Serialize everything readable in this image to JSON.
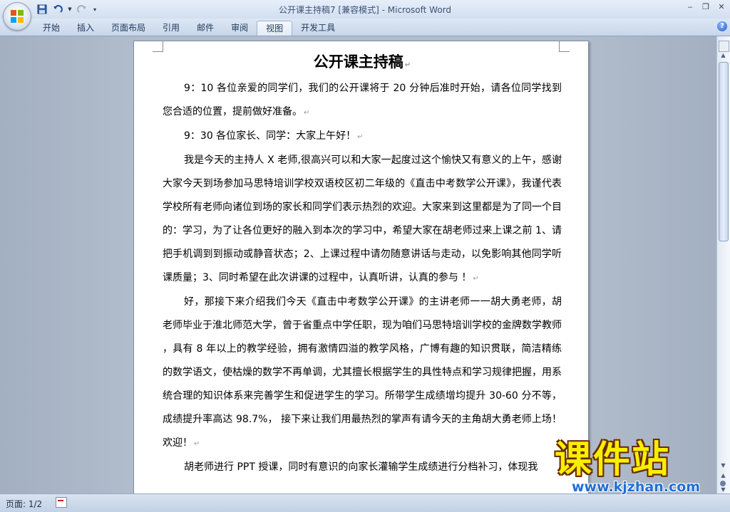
{
  "window": {
    "title_doc": "公开课主持稿7 [兼容模式]",
    "title_sep": " - ",
    "title_app": "Microsoft Word"
  },
  "ribbon": {
    "tabs": [
      {
        "label": "开始"
      },
      {
        "label": "插入"
      },
      {
        "label": "页面布局"
      },
      {
        "label": "引用"
      },
      {
        "label": "邮件"
      },
      {
        "label": "审阅"
      },
      {
        "label": "视图"
      },
      {
        "label": "开发工具"
      }
    ],
    "active_tab": "视图"
  },
  "document": {
    "title": "公开课主持稿",
    "paragraphs": [
      "9：10 各位亲爱的同学们，我们的公开课将于 20 分钟后准时开始，请各位同学找到您合适的位置，提前做好准备。",
      "9：30 各位家长、同学：大家上午好！",
      "我是今天的主持人 X 老师,很高兴可以和大家一起度过这个愉快又有意义的上午，感谢大家今天到场参加马思特培训学校双语校区初二年级的《直击中考数学公开课》，我谨代表学校所有老师向诸位到场的家长和同学们表示热烈的欢迎。大家来到这里都是为了同一个目的：学习，为了让各位更好的融入到本次的学习中，希望大家在胡老师过来上课之前 1、请把手机调到到振动或静音状态；2、上课过程中请勿随意讲话与走动，以免影响其他同学听课质量；3、同时希望在此次讲课的过程中，认真听讲，认真的参与 ！",
      "好，那接下来介绍我们今天《直击中考数学公开课》的主讲老师一一胡大勇老师，胡老师毕业于淮北师范大学，曾于省重点中学任职，现为咱们马思特培训学校的金牌数学教师 ，具有 8 年以上的教学经验，拥有激情四溢的教学风格，广博有趣的知识贯联，简洁精练的数学语文，使枯燥的数学不再单调，尤其擅长根据学生的具性特点和学习规律把握，用系统合理的知识体系来完善学生和促进学生的学习。所带学生成绩增均提升 30-60 分不等，成绩提升率高达 98.7%， 接下来让我们用最热烈的掌声有请今天的主角胡大勇老师上场！欢迎！",
      "胡老师进行 PPT 授课，同时有意识的向家长灌输学生成绩进行分档补习，体现我"
    ]
  },
  "status": {
    "page": "页面: 1/2"
  },
  "watermark": {
    "main": "课件站",
    "url": "www.kjzhan.com"
  }
}
